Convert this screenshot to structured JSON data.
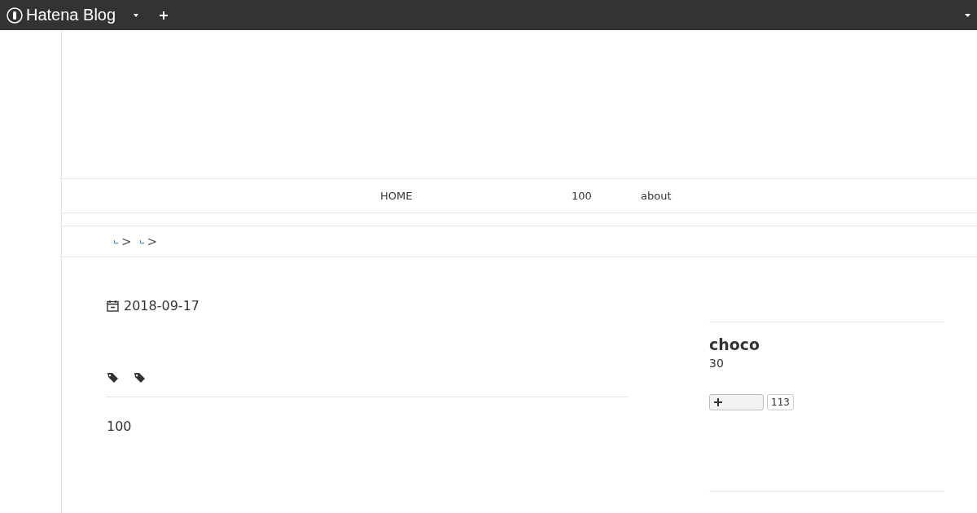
{
  "topbar": {
    "logo": "Hatena Blog"
  },
  "nav": [
    {
      "label": "HOME"
    },
    {
      "label": "100"
    },
    {
      "label": "about"
    }
  ],
  "breadcrumb": [
    {
      "separator": ">"
    },
    {
      "separator": ">"
    }
  ],
  "entry": {
    "date": "2018-09-17",
    "tags": [
      {
        "kind": "tag"
      },
      {
        "kind": "tag"
      }
    ],
    "body": "100"
  },
  "sidebar": {
    "name": "choco",
    "subtitle": "30",
    "follow_count": "113"
  }
}
